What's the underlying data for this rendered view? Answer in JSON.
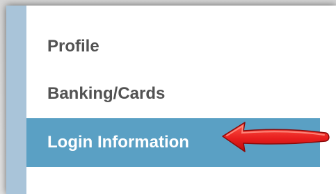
{
  "nav": {
    "items": [
      {
        "label": "Profile",
        "active": false
      },
      {
        "label": "Banking/Cards",
        "active": false
      },
      {
        "label": "Login Information",
        "active": true
      }
    ]
  },
  "colors": {
    "active_bg": "#5aa0c4",
    "side_strip": "#a9c4d9",
    "text": "#525252",
    "arrow": "#e81e1e"
  },
  "annotation": {
    "icon": "red-arrow-icon"
  }
}
